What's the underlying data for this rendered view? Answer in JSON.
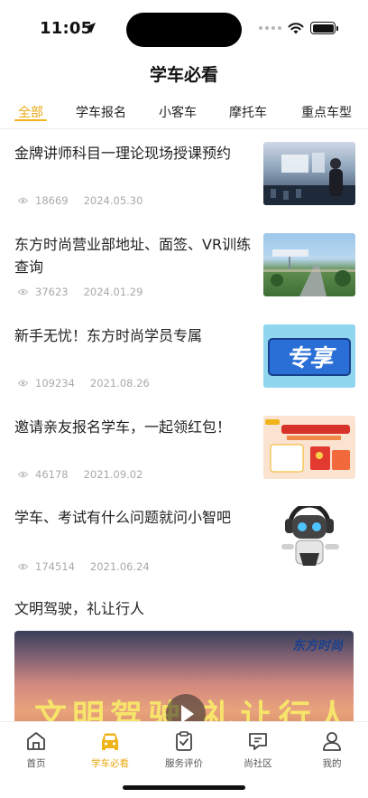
{
  "status_bar": {
    "time": "11:05"
  },
  "page": {
    "title": "学车必看"
  },
  "tabs": [
    {
      "label": "全部",
      "active": true
    },
    {
      "label": "学车报名",
      "active": false
    },
    {
      "label": "小客车",
      "active": false
    },
    {
      "label": "摩托车",
      "active": false
    },
    {
      "label": "重点车型",
      "active": false
    }
  ],
  "articles": [
    {
      "title": "金牌讲师科目一理论现场授课预约",
      "views": "18669",
      "date": "2024.05.30",
      "thumb": "classroom-photo"
    },
    {
      "title": "东方时尚营业部地址、面签、VR训练查询",
      "views": "37623",
      "date": "2024.01.29",
      "thumb": "campus-aerial-photo"
    },
    {
      "title": "新手无忧！东方时尚学员专属",
      "views": "109234",
      "date": "2021.08.26",
      "thumb": "专享"
    },
    {
      "title": "邀请亲友报名学车，一起领红包！",
      "views": "46178",
      "date": "2021.09.02",
      "thumb": "red-envelope-promo"
    },
    {
      "title": "学车、考试有什么问题就问小智吧",
      "views": "174514",
      "date": "2021.06.24",
      "thumb": "robot-assistant"
    }
  ],
  "video": {
    "title": "文明驾驶，礼让行人",
    "logo_text": "东方时尚",
    "overlay_text": "文明驾驶 礼让行人"
  },
  "bottom_nav": [
    {
      "label": "首页",
      "icon": "home-icon",
      "active": false
    },
    {
      "label": "学车必看",
      "icon": "car-icon",
      "active": true
    },
    {
      "label": "服务评价",
      "icon": "clipboard-check-icon",
      "active": false
    },
    {
      "label": "尚社区",
      "icon": "chat-icon",
      "active": false
    },
    {
      "label": "我的",
      "icon": "person-icon",
      "active": false
    }
  ],
  "colors": {
    "accent": "#f0b31a",
    "meta": "#aaaaaa"
  }
}
